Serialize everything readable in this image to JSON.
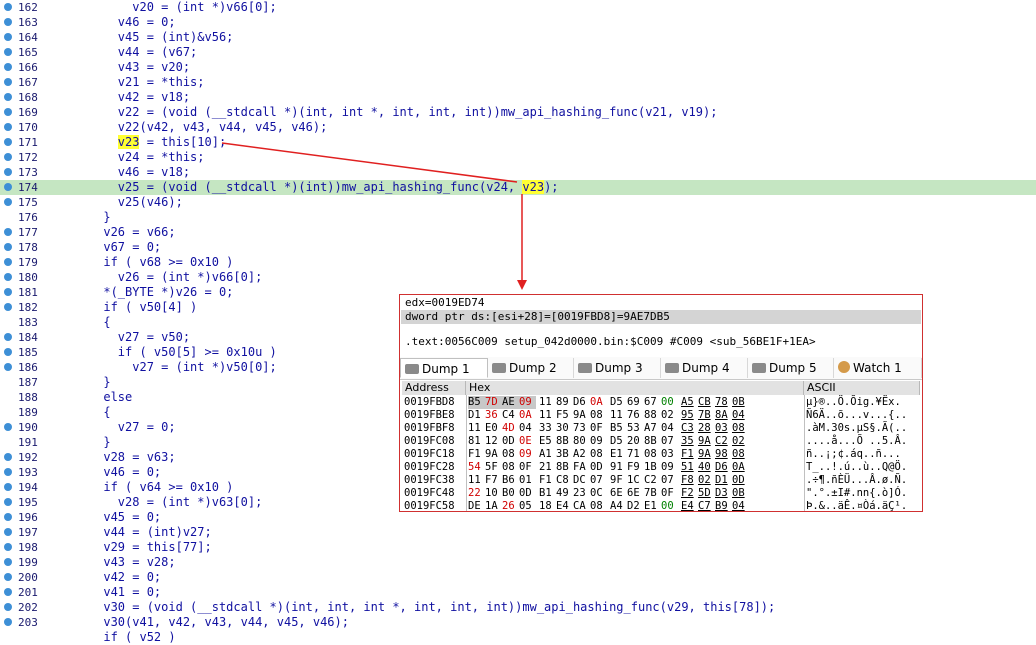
{
  "code": [
    {
      "n": "162",
      "bp": true,
      "t": "          v20 = (int *)v66[0];"
    },
    {
      "n": "163",
      "bp": true,
      "t": "        v46 = 0;"
    },
    {
      "n": "164",
      "bp": true,
      "t": "        v45 = (int)&v56;"
    },
    {
      "n": "165",
      "bp": true,
      "t": "        v44 = (v67;"
    },
    {
      "n": "166",
      "bp": true,
      "t": "        v43 = v20;"
    },
    {
      "n": "167",
      "bp": true,
      "t": "        v21 = *this;"
    },
    {
      "n": "168",
      "bp": true,
      "t": "        v42 = v18;"
    },
    {
      "n": "169",
      "bp": true,
      "t": "        v22 = (void (__stdcall *)(int, int *, int, int, int))mw_api_hashing_func(v21, v19);"
    },
    {
      "n": "170",
      "bp": true,
      "t": "        v22(v42, v43, v44, v45, v46);"
    },
    {
      "n": "171",
      "bp": true,
      "t": "        v23 = this[10];"
    },
    {
      "n": "172",
      "bp": true,
      "t": "        v24 = *this;"
    },
    {
      "n": "173",
      "bp": true,
      "t": "        v46 = v18;"
    },
    {
      "n": "174",
      "bp": true,
      "t": "        v25 = (void (__stdcall *)(int))mw_api_hashing_func(v24, v23);",
      "hl": true
    },
    {
      "n": "175",
      "bp": true,
      "t": "        v25(v46);"
    },
    {
      "n": "176",
      "bp": false,
      "t": "      }"
    },
    {
      "n": "177",
      "bp": true,
      "t": "      v26 = v66;"
    },
    {
      "n": "178",
      "bp": true,
      "t": "      v67 = 0;"
    },
    {
      "n": "179",
      "bp": true,
      "t": "      if ( v68 >= 0x10 )"
    },
    {
      "n": "180",
      "bp": true,
      "t": "        v26 = (int *)v66[0];"
    },
    {
      "n": "181",
      "bp": true,
      "t": "      *(_BYTE *)v26 = 0;"
    },
    {
      "n": "182",
      "bp": true,
      "t": "      if ( v50[4] )"
    },
    {
      "n": "183",
      "bp": false,
      "t": "      {"
    },
    {
      "n": "184",
      "bp": true,
      "t": "        v27 = v50;"
    },
    {
      "n": "185",
      "bp": true,
      "t": "        if ( v50[5] >= 0x10u )"
    },
    {
      "n": "186",
      "bp": true,
      "t": "          v27 = (int *)v50[0];"
    },
    {
      "n": "187",
      "bp": false,
      "t": "      }"
    },
    {
      "n": "188",
      "bp": false,
      "t": "      else"
    },
    {
      "n": "189",
      "bp": false,
      "t": "      {"
    },
    {
      "n": "190",
      "bp": true,
      "t": "        v27 = 0;"
    },
    {
      "n": "191",
      "bp": false,
      "t": "      }"
    },
    {
      "n": "192",
      "bp": true,
      "t": "      v28 = v63;"
    },
    {
      "n": "193",
      "bp": true,
      "t": "      v46 = 0;"
    },
    {
      "n": "194",
      "bp": true,
      "t": "      if ( v64 >= 0x10 )"
    },
    {
      "n": "195",
      "bp": true,
      "t": "        v28 = (int *)v63[0];"
    },
    {
      "n": "196",
      "bp": true,
      "t": "      v45 = 0;"
    },
    {
      "n": "197",
      "bp": true,
      "t": "      v44 = (int)v27;"
    },
    {
      "n": "198",
      "bp": true,
      "t": "      v29 = this[77];"
    },
    {
      "n": "199",
      "bp": true,
      "t": "      v43 = v28;"
    },
    {
      "n": "200",
      "bp": true,
      "t": "      v42 = 0;"
    },
    {
      "n": "201",
      "bp": true,
      "t": "      v41 = 0;"
    },
    {
      "n": "202",
      "bp": true,
      "t": "      v30 = (void (__stdcall *)(int, int, int *, int, int, int))mw_api_hashing_func(v29, this[78]);"
    },
    {
      "n": "203",
      "bp": true,
      "t": "      v30(v41, v42, v43, v44, v45, v46);"
    },
    {
      "n": "",
      "bp": false,
      "t": "      if ( v52 )"
    }
  ],
  "debugger": {
    "line1": "edx=0019ED74",
    "line2": "dword ptr ds:[esi+28]=[0019FBD8]=9AE7DB5",
    "line3": ".text:0056C009 setup_042d0000.bin:$C009 #C009 <sub_56BE1F+1EA>",
    "tabs": [
      {
        "label": "Dump 1",
        "icon": "memory-icon",
        "active": true
      },
      {
        "label": "Dump 2",
        "icon": "memory-icon",
        "active": false
      },
      {
        "label": "Dump 3",
        "icon": "memory-icon",
        "active": false
      },
      {
        "label": "Dump 4",
        "icon": "memory-icon",
        "active": false
      },
      {
        "label": "Dump 5",
        "icon": "memory-icon",
        "active": false
      },
      {
        "label": "Watch 1",
        "icon": "cat-icon",
        "active": false
      }
    ],
    "columns": {
      "address": "Address",
      "hex": "Hex",
      "ascii": "ASCII"
    },
    "rows": [
      {
        "addr": "0019FBD8",
        "hex": [
          "B5",
          "7D",
          "AE",
          "09",
          "11",
          "89",
          "D6",
          "0A",
          "D5",
          "69",
          "67",
          "00",
          "A5",
          "CB",
          "78",
          "0B"
        ],
        "ascii": "µ}®..Ö.Õig.¥Ëx."
      },
      {
        "addr": "0019FBE8",
        "hex": [
          "D1",
          "36",
          "C4",
          "0A",
          "11",
          "F5",
          "9A",
          "08",
          "11",
          "76",
          "88",
          "02",
          "95",
          "7B",
          "8A",
          "04"
        ],
        "ascii": "Ñ6Ä..õ...v...{.."
      },
      {
        "addr": "0019FBF8",
        "hex": [
          "11",
          "E0",
          "4D",
          "04",
          "33",
          "30",
          "73",
          "0F",
          "B5",
          "53",
          "A7",
          "04",
          "C3",
          "28",
          "03",
          "08"
        ],
        "ascii": ".àM.30s.µS§.Ã(.."
      },
      {
        "addr": "0019FC08",
        "hex": [
          "81",
          "12",
          "0D",
          "0E",
          "E5",
          "8B",
          "80",
          "09",
          "D5",
          "20",
          "8B",
          "07",
          "35",
          "9A",
          "C2",
          "02"
        ],
        "ascii": "....å...Õ ..5.Â."
      },
      {
        "addr": "0019FC18",
        "hex": [
          "F1",
          "9A",
          "08",
          "09",
          "A1",
          "3B",
          "A2",
          "08",
          "E1",
          "71",
          "08",
          "03",
          "F1",
          "9A",
          "98",
          "08"
        ],
        "ascii": "ñ..¡;¢.áq..ñ..."
      },
      {
        "addr": "0019FC28",
        "hex": [
          "54",
          "5F",
          "08",
          "0F",
          "21",
          "8B",
          "FA",
          "0D",
          "91",
          "F9",
          "1B",
          "09",
          "51",
          "40",
          "D6",
          "0A"
        ],
        "ascii": "T_..!.ú..ù..Q@Ö."
      },
      {
        "addr": "0019FC38",
        "hex": [
          "11",
          "F7",
          "B6",
          "01",
          "F1",
          "C8",
          "DC",
          "07",
          "9F",
          "1C",
          "C2",
          "07",
          "F8",
          "02",
          "D1",
          "0D"
        ],
        "ascii": ".÷¶.ñÈÜ...Â.ø.Ñ."
      },
      {
        "addr": "0019FC48",
        "hex": [
          "22",
          "10",
          "B0",
          "0D",
          "B1",
          "49",
          "23",
          "0C",
          "6E",
          "6E",
          "7B",
          "0F",
          "F2",
          "5D",
          "D3",
          "0B"
        ],
        "ascii": "\".°.±I#.nn{.ò]Ó."
      },
      {
        "addr": "0019FC58",
        "hex": [
          "DE",
          "1A",
          "26",
          "05",
          "18",
          "E4",
          "CA",
          "08",
          "A4",
          "D2",
          "E1",
          "00",
          "E4",
          "C7",
          "B9",
          "04"
        ],
        "ascii": "Þ.&..äÊ.¤Òá.äÇ¹."
      }
    ]
  }
}
